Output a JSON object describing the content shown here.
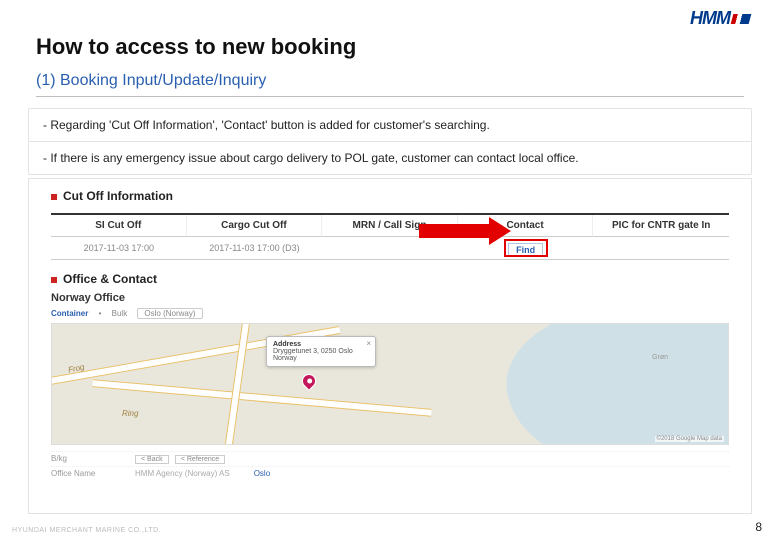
{
  "logo_text": "HMM",
  "title": "How to access to new booking",
  "subtitle": "(1) Booking Input/Update/Inquiry",
  "notes": {
    "n1": "-  Regarding 'Cut Off Information', 'Contact' button is added for customer's searching.",
    "n2": "-  If there is any emergency issue about cargo delivery to POL gate, customer can contact local office."
  },
  "cutoff": {
    "section_title": "Cut Off Information",
    "cols": {
      "c0": {
        "hd": "SI Cut Off",
        "val": "2017-11-03 17:00"
      },
      "c1": {
        "hd": "Cargo Cut Off",
        "val": "2017-11-03 17:00 (D3)"
      },
      "c2": {
        "hd": "MRN / Call Sign",
        "val": ""
      },
      "c3": {
        "hd": "Contact",
        "val": ""
      },
      "c4": {
        "hd": "PIC for CNTR gate In",
        "val": ""
      }
    },
    "find_label": "Find"
  },
  "office": {
    "section_title": "Office & Contact",
    "office_name": "Norway Office",
    "tab_a": "Container",
    "tab_b": "Bulk",
    "selector": "Oslo (Norway)"
  },
  "map": {
    "road1": "Frog",
    "road2": "Ring",
    "area1": "Grøn",
    "callout_title": "Address",
    "callout_line1": "Dryggetunet 3, 0250 Oslo",
    "callout_line2": "Norway",
    "attribution": "©2018 Google Map data"
  },
  "faint": {
    "row1_lbl": "B/kg",
    "btn1": "< Back",
    "btn2": "< Reference",
    "row2_lbl": "Office Name",
    "row2_val": "HMM Agency (Norway) AS",
    "row3_lbl": "",
    "oslo": "Oslo"
  },
  "footer": "HYUNDAI MERCHANT MARINE CO.,LTD.",
  "page": "8"
}
